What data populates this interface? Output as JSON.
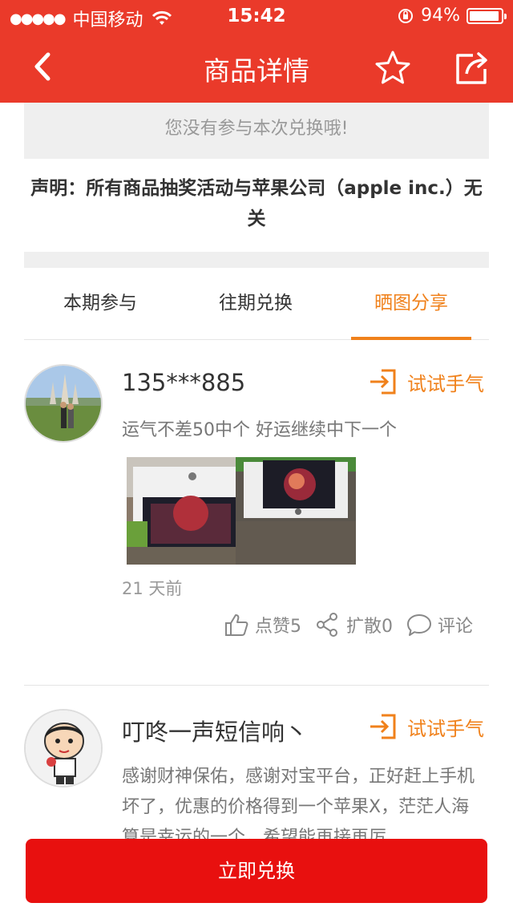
{
  "status": {
    "carrier": "中国移动",
    "time": "15:42",
    "battery": "94%",
    "battery_level": 0.94
  },
  "nav": {
    "title": "商品详情"
  },
  "notice": "您没有参与本次兑换哦!",
  "disclaimer": "声明：所有商品抽奖活动与苹果公司（apple inc.）无关",
  "tabs": [
    "本期参与",
    "往期兑换",
    "晒图分享"
  ],
  "active_tab": 2,
  "posts": [
    {
      "username": "135***885",
      "try_label": "试试手气",
      "content": "运气不差50中个 好运继续中下一个",
      "time_ago": "21 天前",
      "like_label": "点赞5",
      "share_label": "扩散0",
      "comment_label": "评论"
    },
    {
      "username": "叮咚一声短信响丶",
      "try_label": "试试手气",
      "content": "感谢财神保佑，感谢对宝平台，正好赶上手机坏了，优惠的价格得到一个苹果X，茫茫人海算是幸运的一个，希望能再接再厉"
    }
  ],
  "cta_label": "立即兑换",
  "colors": {
    "header": "#ea3a2a",
    "accent": "#f0811b",
    "cta": "#e8100f"
  }
}
